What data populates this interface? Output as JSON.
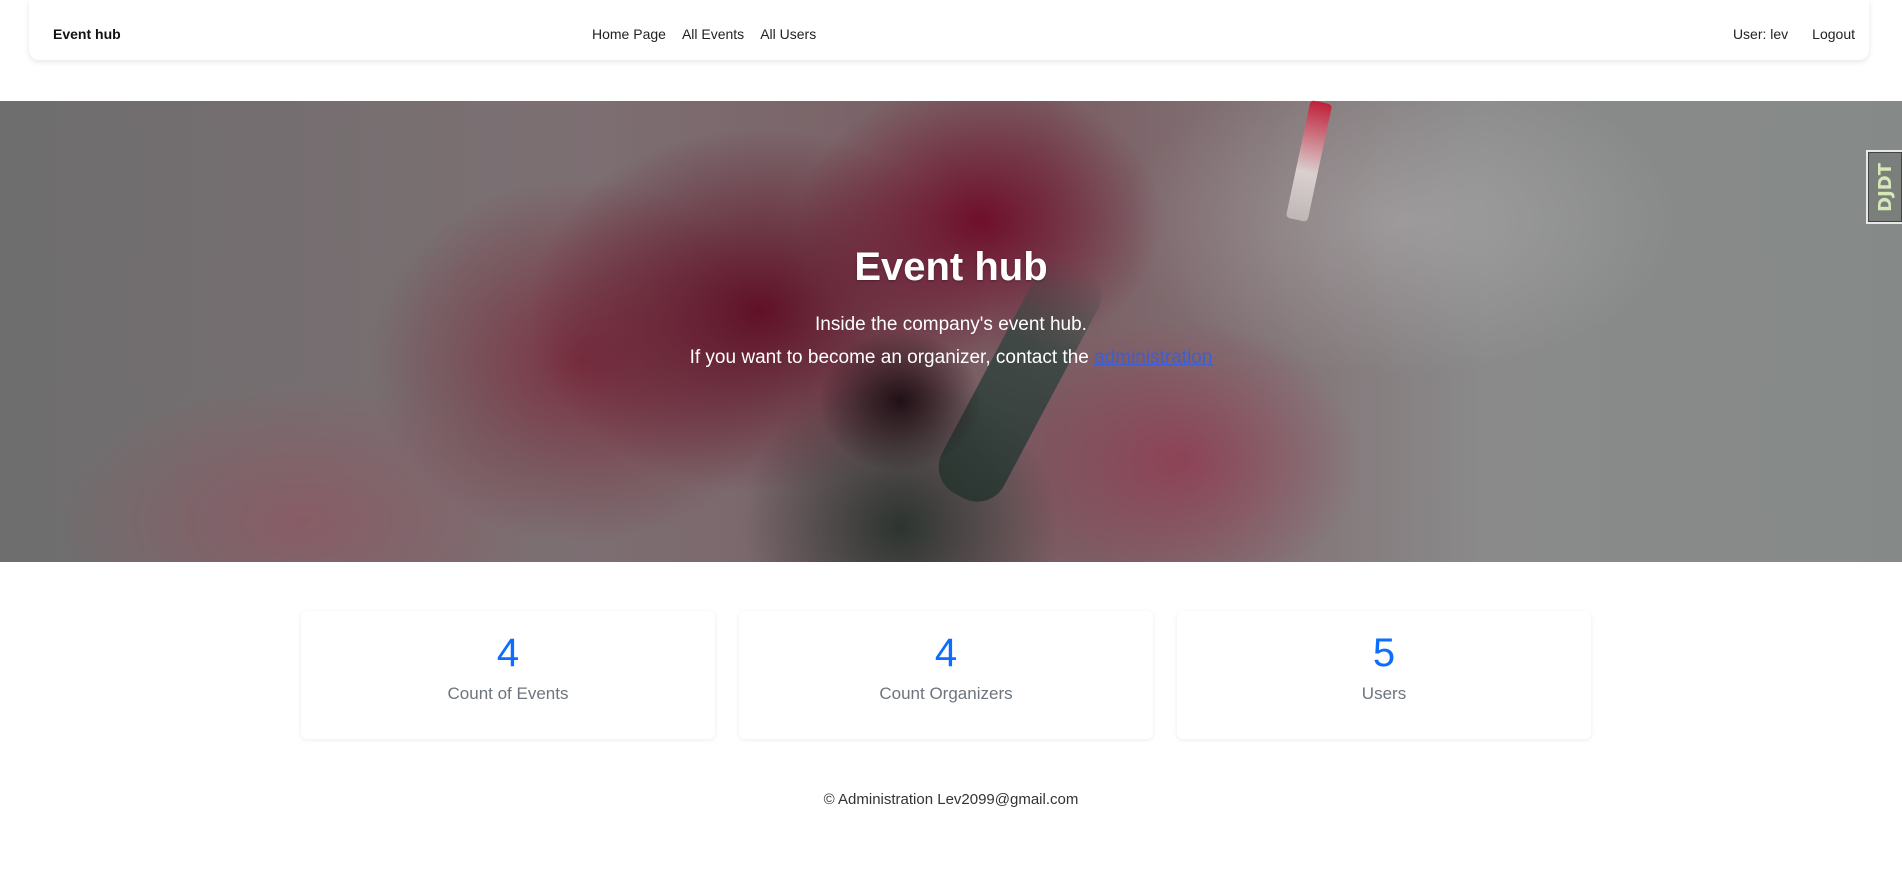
{
  "navbar": {
    "brand": "Event hub",
    "links": [
      "Home Page",
      "All Events",
      "All Users"
    ],
    "user_label": "User: lev",
    "logout_label": "Logout"
  },
  "hero": {
    "title": "Event hub",
    "line1": "Inside the company's event hub.",
    "line2_prefix": "If you want to become an organizer, contact the ",
    "line2_link": "administration"
  },
  "side_widget": {
    "label": "DJDT"
  },
  "stats": [
    {
      "value": "4",
      "label": "Count of Events"
    },
    {
      "value": "4",
      "label": "Count Organizers"
    },
    {
      "value": "5",
      "label": "Users"
    }
  ],
  "footer": {
    "text": "© Administration Lev2099@gmail.com"
  },
  "colors": {
    "accent": "#0d6efd",
    "link": "#3a5fd6"
  }
}
